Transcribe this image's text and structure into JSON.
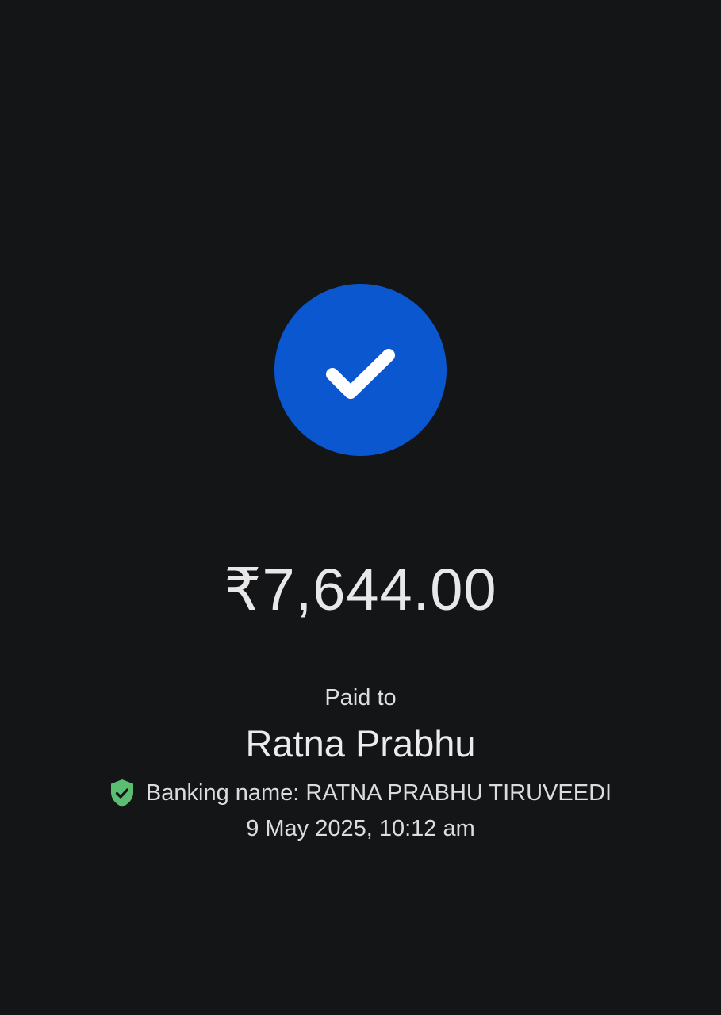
{
  "payment": {
    "amount": "₹7,644.00",
    "paid_to_label": "Paid to",
    "payee_name": "Ratna Prabhu",
    "banking_name": "Banking name: RATNA PRABHU TIRUVEEDI",
    "timestamp": "9 May 2025, 10:12 am"
  },
  "icons": {
    "status": "check-circle-icon",
    "verified": "verified-shield-icon"
  },
  "colors": {
    "background": "#141517",
    "success_circle": "#0b57d0",
    "verified_shield": "#5bbd72"
  }
}
